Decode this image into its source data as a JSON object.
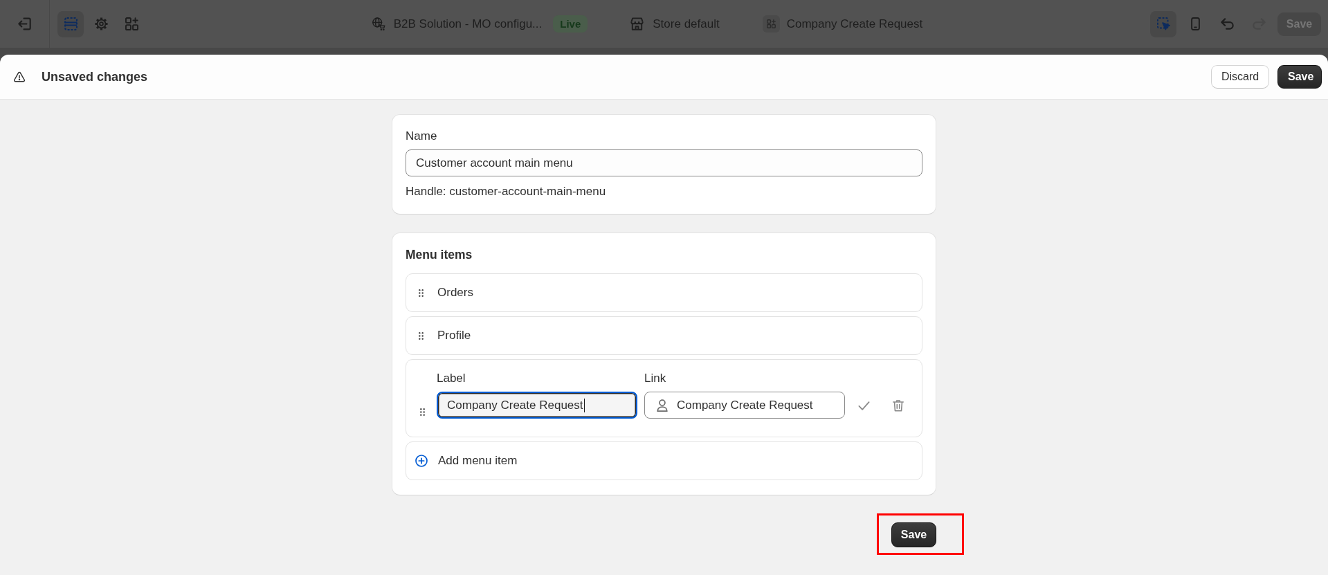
{
  "top_bar": {
    "tools": [
      {
        "kind": "sections",
        "selected": true
      },
      {
        "kind": "settings",
        "selected": false
      },
      {
        "kind": "apps",
        "selected": false
      }
    ],
    "theme": {
      "name": "B2B Solution - MO configu...",
      "badge": "Live"
    },
    "store": {
      "name": "Store default"
    },
    "page": {
      "name": "Company Create Request"
    },
    "view_tools": [
      {
        "kind": "inspector",
        "selected": true
      },
      {
        "kind": "mobile",
        "selected": false
      }
    ],
    "history": [
      {
        "kind": "undo",
        "disabled": false
      },
      {
        "kind": "redo",
        "disabled": true
      }
    ],
    "save_button": {
      "label": "Save",
      "disabled": true
    }
  },
  "unsaved_bar": {
    "title": "Unsaved changes",
    "buttons": [
      {
        "kind": "secondary",
        "label": "Discard"
      },
      {
        "kind": "primary",
        "label": "Save"
      }
    ]
  },
  "name_card": {
    "label": "Name",
    "value": "Customer account main menu",
    "handle": "Handle: customer-account-main-menu"
  },
  "menu_card": {
    "title": "Menu items",
    "items": [
      {
        "kind": "item",
        "label": "Orders"
      },
      {
        "kind": "item",
        "label": "Profile"
      },
      {
        "kind": "edit",
        "label_field": {
          "label": "Label",
          "value": "Company Create Request",
          "focused": true
        },
        "link_field": {
          "label": "Link",
          "value": "Company Create Request"
        }
      }
    ],
    "add_button": "Add menu item"
  },
  "footer": {
    "save_button": {
      "label": "Save",
      "highlighted": true
    }
  }
}
